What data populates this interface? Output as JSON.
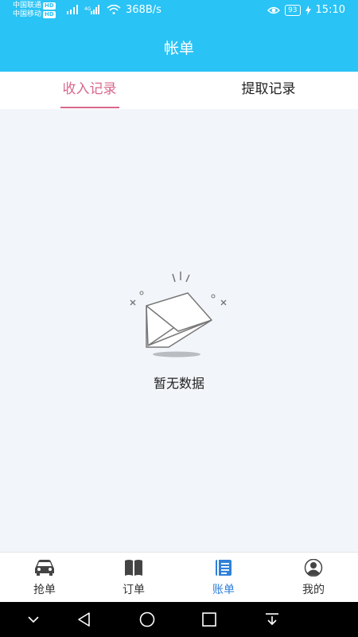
{
  "status_bar": {
    "carrier1": "中国联通",
    "carrier2": "中国移动",
    "hd": "HD",
    "net1": "4G",
    "speed": "368B/s",
    "battery": "93",
    "time": "15:10"
  },
  "header": {
    "title": "帐单"
  },
  "tabs": [
    {
      "label": "收入记录",
      "active": true
    },
    {
      "label": "提取记录",
      "active": false
    }
  ],
  "empty_state": {
    "text": "暂无数据"
  },
  "bottom_nav": [
    {
      "label": "抢单",
      "icon": "car-icon"
    },
    {
      "label": "订单",
      "icon": "book-icon"
    },
    {
      "label": "账单",
      "icon": "bill-icon",
      "active": true
    },
    {
      "label": "我的",
      "icon": "person-icon"
    }
  ],
  "colors": {
    "header_bg": "#29c3f5",
    "active_tab": "#d9688a",
    "active_nav": "#2f80d9"
  }
}
